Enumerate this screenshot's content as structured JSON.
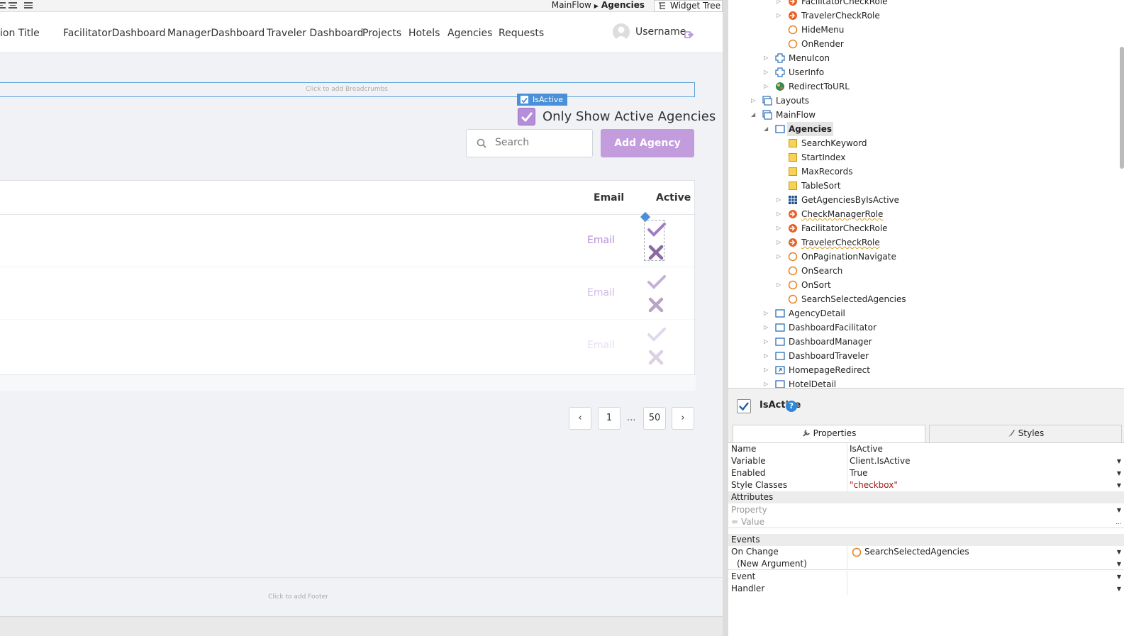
{
  "topbar": {
    "crumb_flow": "MainFlow",
    "crumb_screen": "Agencies",
    "widget_tree_tab": "Widget Tree"
  },
  "header": {
    "app_title": "ion Title",
    "nav": [
      "FacilitatorDashboard",
      "ManagerDashboard",
      "Traveler Dashboard",
      "Projects",
      "Hotels",
      "Agencies",
      "Requests"
    ],
    "username": "Username"
  },
  "page": {
    "breadcrumbs_placeholder": "Click to add Breadcrumbs",
    "selected_tag": "IsActive",
    "only_active_label": "Only Show Active Agencies",
    "search_placeholder": "Search",
    "add_button": "Add Agency",
    "table": {
      "headers": [
        "Email",
        "Active"
      ],
      "rows": [
        {
          "email": "Email",
          "opacity": 1.0
        },
        {
          "email": "Email",
          "opacity": 0.6
        },
        {
          "email": "Email",
          "opacity": 0.3
        }
      ]
    },
    "pagination": {
      "first": "1",
      "ellipsis": "...",
      "last": "50",
      "prev": "‹",
      "next": "›"
    },
    "footer_placeholder": "Click to add Footer"
  },
  "tree": {
    "nodes": [
      {
        "label": "FacilitatorCheckRole",
        "icon": "action-icon",
        "expandable": true
      },
      {
        "label": "TravelerCheckRole",
        "icon": "action-icon",
        "expandable": true
      },
      {
        "label": "HideMenu",
        "icon": "event-icon",
        "expandable": false
      },
      {
        "label": "OnRender",
        "icon": "event-icon",
        "expandable": false
      },
      {
        "label": "MenuIcon",
        "icon": "block-icon",
        "expandable": true
      },
      {
        "label": "UserInfo",
        "icon": "block-icon",
        "expandable": true
      },
      {
        "label": "RedirectToURL",
        "icon": "globe-icon",
        "expandable": true
      },
      {
        "label": "Layouts",
        "icon": "flow-icon",
        "expandable": true
      },
      {
        "label": "MainFlow",
        "icon": "flow-icon",
        "expandable": true
      },
      {
        "label": "Agencies",
        "icon": "screen-icon",
        "expandable": true
      },
      {
        "label": "SearchKeyword",
        "icon": "variable-icon",
        "expandable": false
      },
      {
        "label": "StartIndex",
        "icon": "variable-icon",
        "expandable": false
      },
      {
        "label": "MaxRecords",
        "icon": "variable-icon",
        "expandable": false
      },
      {
        "label": "TableSort",
        "icon": "variable-icon",
        "expandable": false
      },
      {
        "label": "GetAgenciesByIsActive",
        "icon": "aggregate-icon",
        "expandable": true
      },
      {
        "label": "CheckManagerRole",
        "icon": "action-icon",
        "expandable": true
      },
      {
        "label": "FacilitatorCheckRole",
        "icon": "action-icon",
        "expandable": true
      },
      {
        "label": "TravelerCheckRole",
        "icon": "action-icon",
        "expandable": true
      },
      {
        "label": "OnPaginationNavigate",
        "icon": "event-icon",
        "expandable": true
      },
      {
        "label": "OnSearch",
        "icon": "event-icon",
        "expandable": false
      },
      {
        "label": "OnSort",
        "icon": "event-icon",
        "expandable": true
      },
      {
        "label": "SearchSelectedAgencies",
        "icon": "event-icon",
        "expandable": false
      },
      {
        "label": "AgencyDetail",
        "icon": "screen-icon",
        "expandable": true
      },
      {
        "label": "DashboardFacilitator",
        "icon": "screen-icon",
        "expandable": true
      },
      {
        "label": "DashboardManager",
        "icon": "screen-icon",
        "expandable": true
      },
      {
        "label": "DashboardTraveler",
        "icon": "screen-icon",
        "expandable": true
      },
      {
        "label": "HomepageRedirect",
        "icon": "redirect-screen-icon",
        "expandable": true
      },
      {
        "label": "HotelDetail",
        "icon": "screen-icon",
        "expandable": true
      }
    ]
  },
  "properties": {
    "title": "IsActive",
    "help": "?",
    "tab_properties": "Properties",
    "tab_styles": "Styles",
    "rows": {
      "name_k": "Name",
      "name_v": "IsActive",
      "variable_k": "Variable",
      "variable_v": "Client.IsActive",
      "enabled_k": "Enabled",
      "enabled_v": "True",
      "style_k": "Style Classes",
      "style_v": "\"checkbox\"",
      "attributes": "Attributes",
      "property_ph": "Property",
      "eq": "=",
      "value_ph": "Value",
      "more": "...",
      "events": "Events",
      "onchange_k": "On Change",
      "onchange_v": "SearchSelectedAgencies",
      "newarg_k": "(New Argument)",
      "event_k": "Event",
      "handler_k": "Handler"
    }
  },
  "colors": {
    "accent": "#b48ed6",
    "button": "#c29cdc",
    "selection": "#4a90d9",
    "check": "#a07cc5",
    "cross": "#8a6aa0"
  }
}
